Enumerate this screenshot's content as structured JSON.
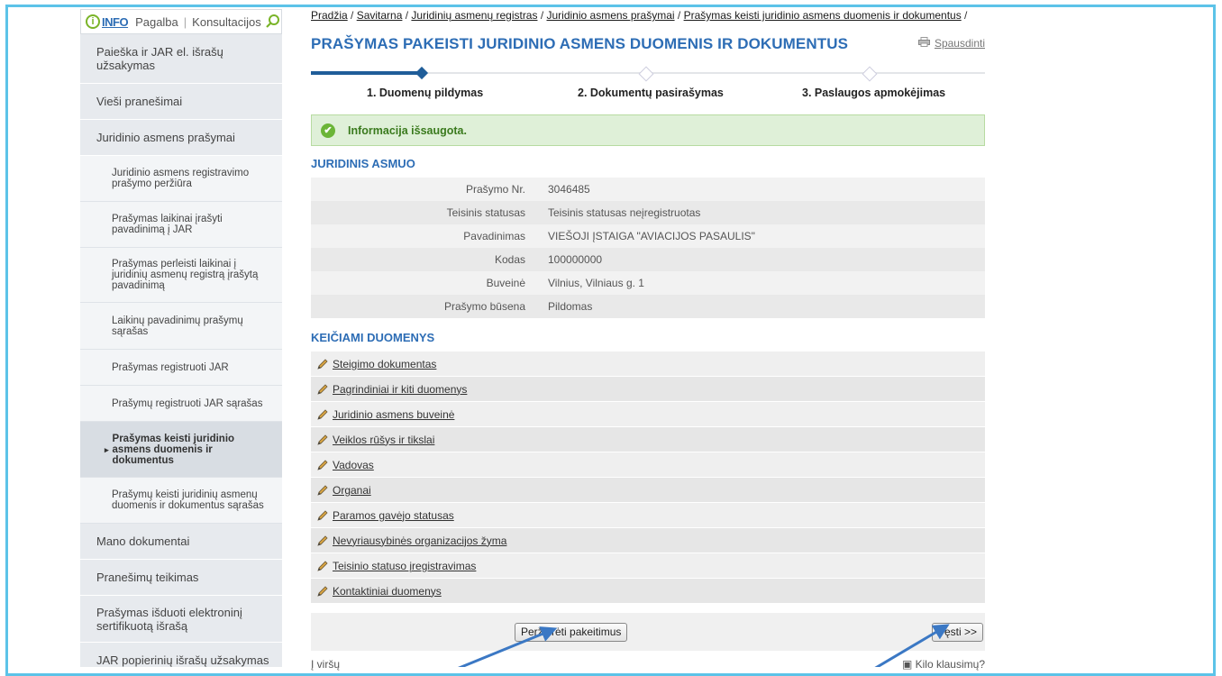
{
  "sidebar": {
    "info": {
      "info_label": "INFO",
      "help_label": "Pagalba",
      "consult_label": "Konsultacijos"
    },
    "items": [
      {
        "label": "Paieška ir JAR el. išrašų užsakymas"
      },
      {
        "label": "Vieši pranešimai"
      },
      {
        "label": "Juridinio asmens prašymai"
      },
      {
        "label": "Juridinio asmens registravimo prašymo peržiūra"
      },
      {
        "label": "Prašymas laikinai įrašyti pavadinimą į JAR"
      },
      {
        "label": "Prašymas perleisti laikinai į juridinių asmenų registrą įrašytą pavadinimą"
      },
      {
        "label": "Laikinų pavadinimų prašymų sąrašas"
      },
      {
        "label": "Prašymas registruoti JAR"
      },
      {
        "label": "Prašymų registruoti JAR sąrašas"
      },
      {
        "label": "Prašymas keisti juridinio asmens duomenis ir dokumentus"
      },
      {
        "label": "Prašymų keisti juridinių asmenų duomenis ir dokumentus sąrašas"
      },
      {
        "label": "Mano dokumentai"
      },
      {
        "label": "Pranešimų teikimas"
      },
      {
        "label": "Prašymas išduoti elektroninį sertifikuotą išrašą"
      },
      {
        "label": "JAR popierinių išrašų užsakymas"
      }
    ]
  },
  "breadcrumb": {
    "items": [
      "Pradžia",
      "Savitarna",
      "Juridinių asmenų registras",
      "Juridinio asmens prašymai",
      "Prašymas keisti juridinio asmens duomenis ir dokumentus"
    ],
    "sep": " / "
  },
  "page": {
    "title": "PRAŠYMAS PAKEISTI JURIDINIO ASMENS DUOMENIS IR DOKUMENTUS",
    "print_label": "Spausdinti"
  },
  "steps": [
    "1. Duomenų pildymas",
    "2. Dokumentų pasirašymas",
    "3. Paslaugos apmokėjimas"
  ],
  "alert": {
    "text": "Informacija išsaugota."
  },
  "entity": {
    "title": "JURIDINIS ASMUO",
    "rows": [
      {
        "key": "Prašymo Nr.",
        "value": "3046485"
      },
      {
        "key": "Teisinis statusas",
        "value": "Teisinis statusas neįregistruotas"
      },
      {
        "key": "Pavadinimas",
        "value": "VIEŠOJI ĮSTAIGA \"AVIACIJOS PASAULIS\""
      },
      {
        "key": "Kodas",
        "value": "100000000"
      },
      {
        "key": "Buveinė",
        "value": "Vilnius, Vilniaus g. 1"
      },
      {
        "key": "Prašymo būsena",
        "value": "Pildomas"
      }
    ]
  },
  "changes": {
    "title": "KEIČIAMI DUOMENYS",
    "links": [
      "Steigimo dokumentas",
      "Pagrindiniai ir kiti duomenys",
      "Juridinio asmens buveinė",
      "Veiklos rūšys ir tikslai",
      "Vadovas",
      "Organai",
      "Paramos gavėjo statusas",
      "Nevyriausybinės organizacijos žyma",
      "Teisinio statuso įregistravimas",
      "Kontaktiniai duomenys"
    ]
  },
  "actions": {
    "review_label": "Peržiūrėti pakeitimus",
    "next_label": "Tęsti >>"
  },
  "footer": {
    "up_label": "Į viršų",
    "question_label": "Kilo klausimų?"
  },
  "colors": {
    "accent": "#2d6db5",
    "step_active": "#1f5d99",
    "success": "#6bb537",
    "annotation_arrow": "#3b78c4",
    "frame": "#5cc3e8"
  }
}
